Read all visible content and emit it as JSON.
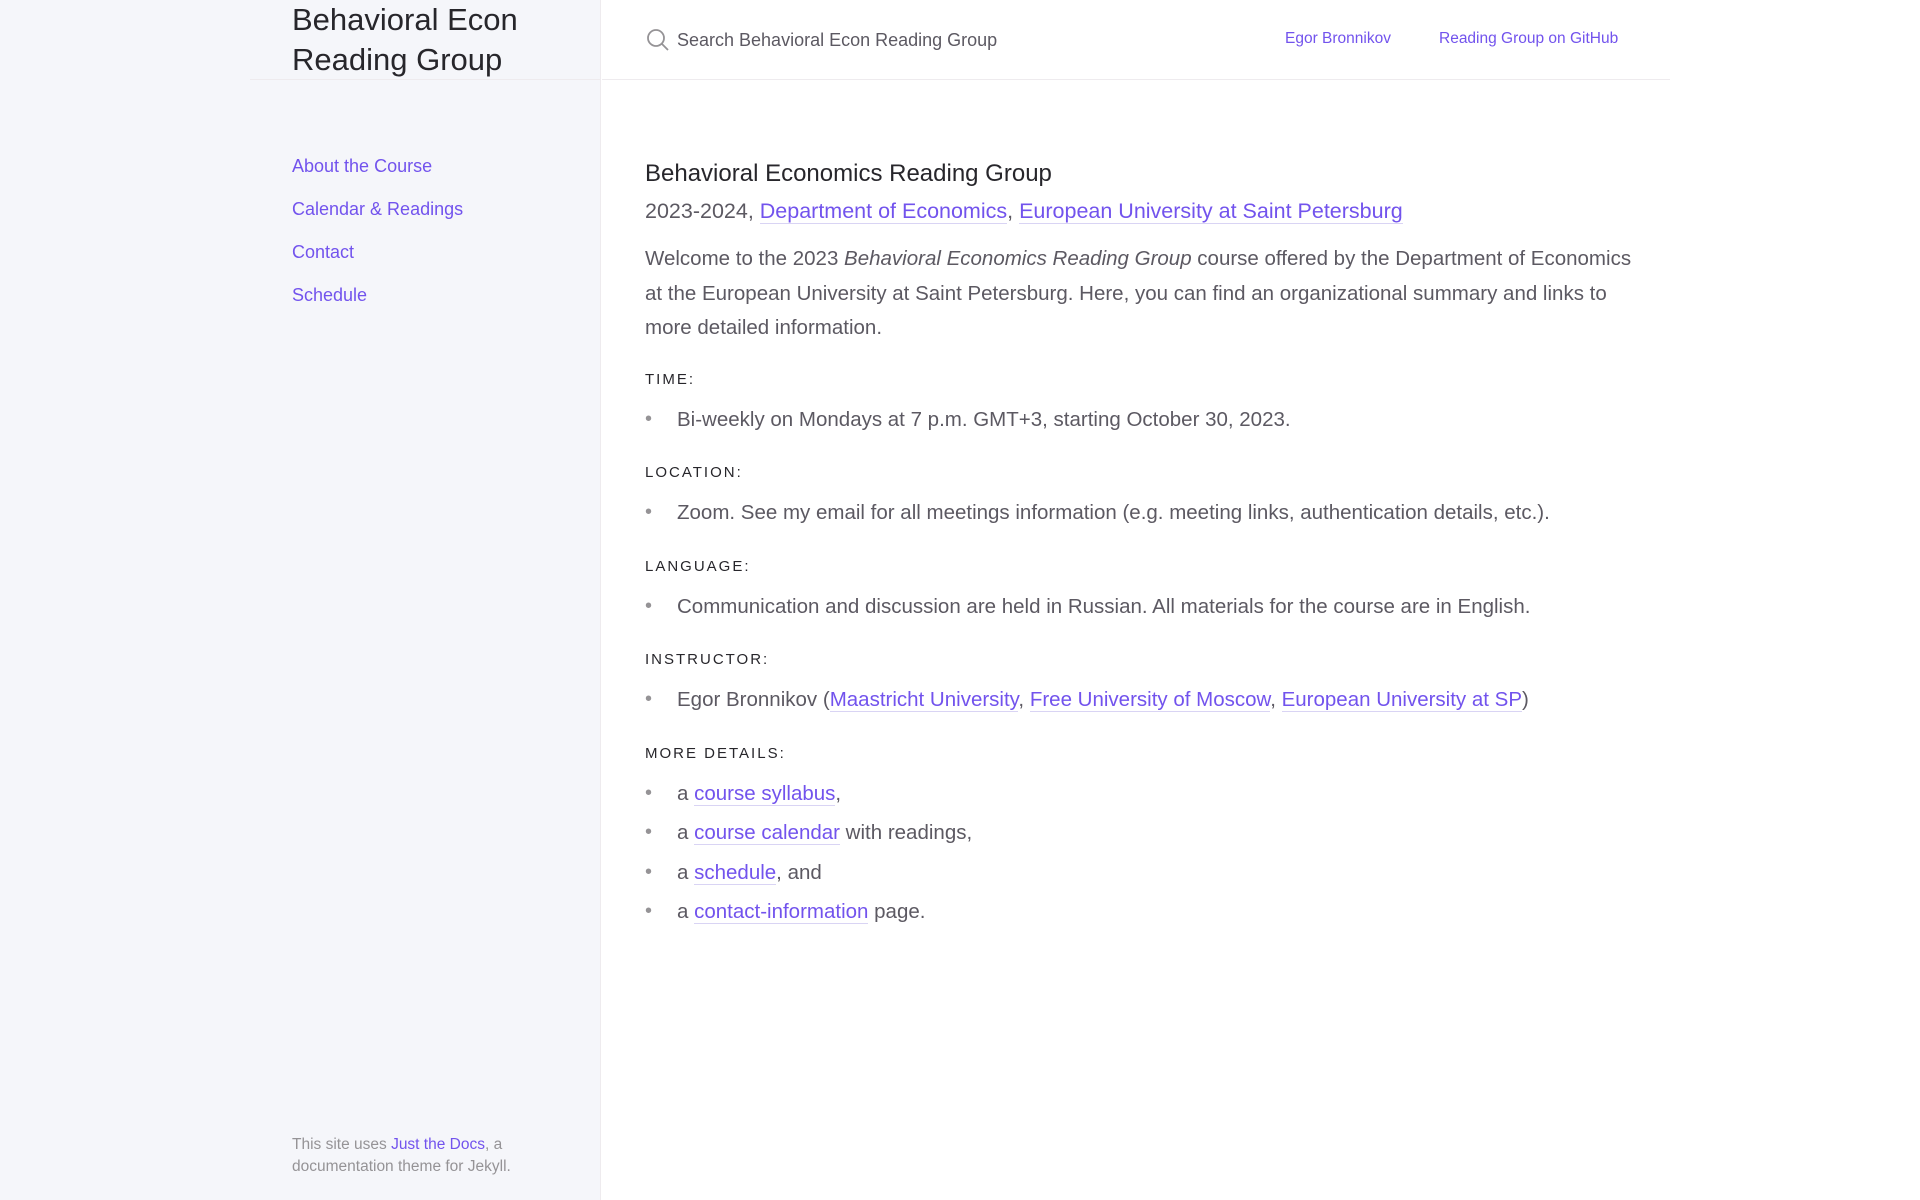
{
  "site": {
    "title": "Behavioral Econ Reading Group"
  },
  "sidebar": {
    "items": [
      {
        "label": "About the Course"
      },
      {
        "label": "Calendar & Readings"
      },
      {
        "label": "Contact"
      },
      {
        "label": "Schedule"
      }
    ],
    "footer": {
      "prefix": "This site uses ",
      "link": "Just the Docs",
      "suffix": ", a documentation theme for Jekyll."
    }
  },
  "header": {
    "search_placeholder": "Search Behavioral Econ Reading Group",
    "aux_links": [
      "Egor Bronnikov",
      "Reading Group on GitHub"
    ]
  },
  "main": {
    "title": "Behavioral Economics Reading Group",
    "subtitle": {
      "years": "2023-2024, ",
      "dept": "Department of Economics",
      "sep": ", ",
      "university": "European University at Saint Petersburg"
    },
    "intro": {
      "before": "Welcome to the 2023 ",
      "em": "Behavioral Economics Reading Group",
      "after": " course offered by the Department of Economics at the European University at Saint Petersburg. Here, you can find an organizational summary and links to more detailed information."
    },
    "time": {
      "label": "TIME:",
      "text": "Bi-weekly on Mondays at 7 p.m. GMT+3, starting October 30, 2023."
    },
    "location": {
      "label": "LOCATION:",
      "text": "Zoom. See my email for all meetings information (e.g. meeting links, authentication details, etc.)."
    },
    "language": {
      "label": "LANGUAGE:",
      "text": "Communication and discussion are held in Russian. All materials for the course are in English."
    },
    "instructor": {
      "label": "INSTRUCTOR:",
      "name": "Egor Bronnikov (",
      "aff1": "Maastricht University",
      "sep1": ", ",
      "aff2": "Free University of Moscow",
      "sep2": ", ",
      "aff3": "European University at SP",
      "close": ")"
    },
    "details": {
      "label": "MORE DETAILS:",
      "items": [
        {
          "pre": "a ",
          "link": "course syllabus",
          "post": ","
        },
        {
          "pre": "a ",
          "link": "course calendar",
          "post": " with readings,"
        },
        {
          "pre": "a ",
          "link": "schedule",
          "post": ", and"
        },
        {
          "pre": "a ",
          "link": "contact-information",
          "post": " page."
        }
      ]
    }
  },
  "colors": {
    "accent": "#7253ed",
    "text": "#5c5962",
    "heading": "#27262b",
    "sidebar_bg": "#f5f6fa"
  }
}
